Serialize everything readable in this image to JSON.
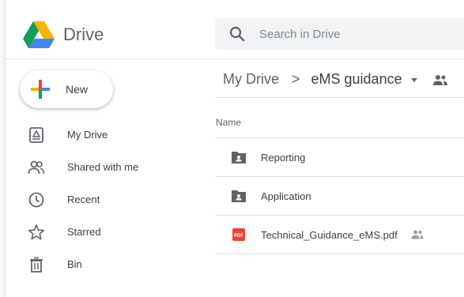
{
  "app": {
    "name": "Drive",
    "logo_icon": "google-drive-logo-icon"
  },
  "search": {
    "placeholder": "Search in Drive",
    "icon": "search-icon"
  },
  "new_button": {
    "label": "New",
    "icon": "plus-icon"
  },
  "sidebar": {
    "items": [
      {
        "label": "My Drive",
        "icon": "my-drive-icon"
      },
      {
        "label": "Shared with me",
        "icon": "shared-with-me-icon"
      },
      {
        "label": "Recent",
        "icon": "clock-icon"
      },
      {
        "label": "Starred",
        "icon": "star-icon"
      },
      {
        "label": "Bin",
        "icon": "trash-icon"
      }
    ]
  },
  "breadcrumb": {
    "root": "My Drive",
    "separator": ">",
    "current": "eMS guidance"
  },
  "file_list": {
    "column_name": "Name",
    "rows": [
      {
        "name": "Reporting",
        "type": "shared-folder",
        "icon": "shared-folder-icon"
      },
      {
        "name": "Application",
        "type": "shared-folder",
        "icon": "shared-folder-icon"
      },
      {
        "name": "Technical_Guidance_eMS.pdf",
        "type": "pdf",
        "icon": "pdf-icon",
        "shared": true
      }
    ]
  },
  "colors": {
    "text": "#3c4043",
    "muted": "#5f6368",
    "search_bg": "#f1f3f4",
    "pdf_red": "#ea4335",
    "drive_green": "#0f9d58",
    "drive_yellow": "#f4b400",
    "drive_blue": "#4285f4"
  }
}
